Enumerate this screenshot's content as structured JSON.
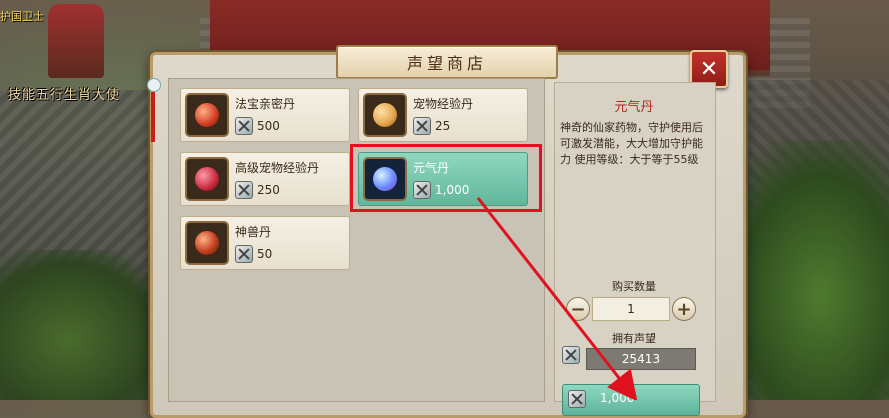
{
  "scene": {
    "npc_label": "五行生肖大使",
    "npc_label_prefix": "技能",
    "npc_top": "护国卫士"
  },
  "shop": {
    "title": "声望商店",
    "close_label": "✕",
    "items": [
      {
        "name": "法宝亲密丹",
        "price": "500",
        "orb": "#d23b1f"
      },
      {
        "name": "宠物经验丹",
        "price": "25",
        "orb": "#e4a34a"
      },
      {
        "name": "高级宠物经验丹",
        "price": "250",
        "orb": "#c8283c"
      },
      {
        "name": "元气丹",
        "price": "1,000",
        "orb": "#6a8cff",
        "selected": true
      },
      {
        "name": "神兽丹",
        "price": "50",
        "orb": "#c2401e"
      }
    ]
  },
  "detail": {
    "title": "元气丹",
    "description": "神奇的仙家药物，守护使用后可激发潜能，大大增加守护能力 使用等级：大于等于55级",
    "quantity_label": "购买数量",
    "quantity_value": "1",
    "minus_label": "−",
    "plus_label": "+",
    "reputation_label": "拥有声望",
    "reputation_value": "25413",
    "buy_price": "1,000"
  },
  "colors": {
    "highlight": "#e0121f",
    "selected_bg": "#62b79c",
    "detail_title": "#b3261e"
  }
}
